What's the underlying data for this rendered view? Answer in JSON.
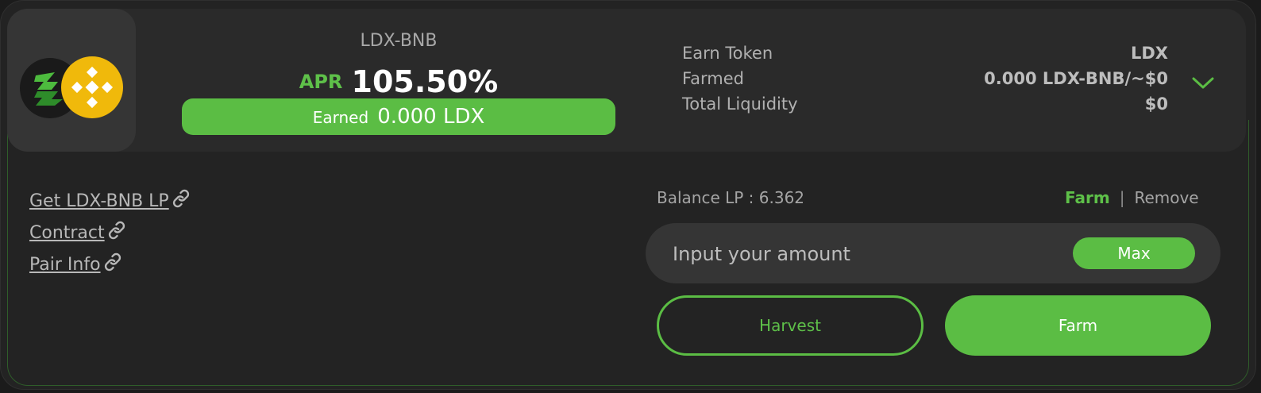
{
  "farm": {
    "pair": "LDX-BNB",
    "apr_label": "APR",
    "apr_value": "105.50%",
    "earned_label": "Earned",
    "earned_value": "0.000 LDX",
    "logos": [
      "ldx-token-icon",
      "bnb-token-icon"
    ]
  },
  "stats": {
    "earn_token_label": "Earn Token",
    "earn_token_value": "LDX",
    "farmed_label": "Farmed",
    "farmed_value": "0.000 LDX-BNB/~$0",
    "liquidity_label": "Total Liquidity",
    "liquidity_value": "$0"
  },
  "links": {
    "get_lp": "Get LDX-BNB LP",
    "contract": "Contract",
    "pair_info": "Pair Info"
  },
  "actions": {
    "balance": "Balance LP : 6.362",
    "tab_farm": "Farm",
    "tab_separator": "|",
    "tab_remove": "Remove",
    "amount_placeholder": "Input your amount",
    "max_label": "Max",
    "harvest_label": "Harvest",
    "farm_label": "Farm"
  },
  "colors": {
    "accent": "#5bbd44",
    "background": "#232323",
    "header": "#2a2a2a",
    "bnb": "#f0b90b"
  }
}
